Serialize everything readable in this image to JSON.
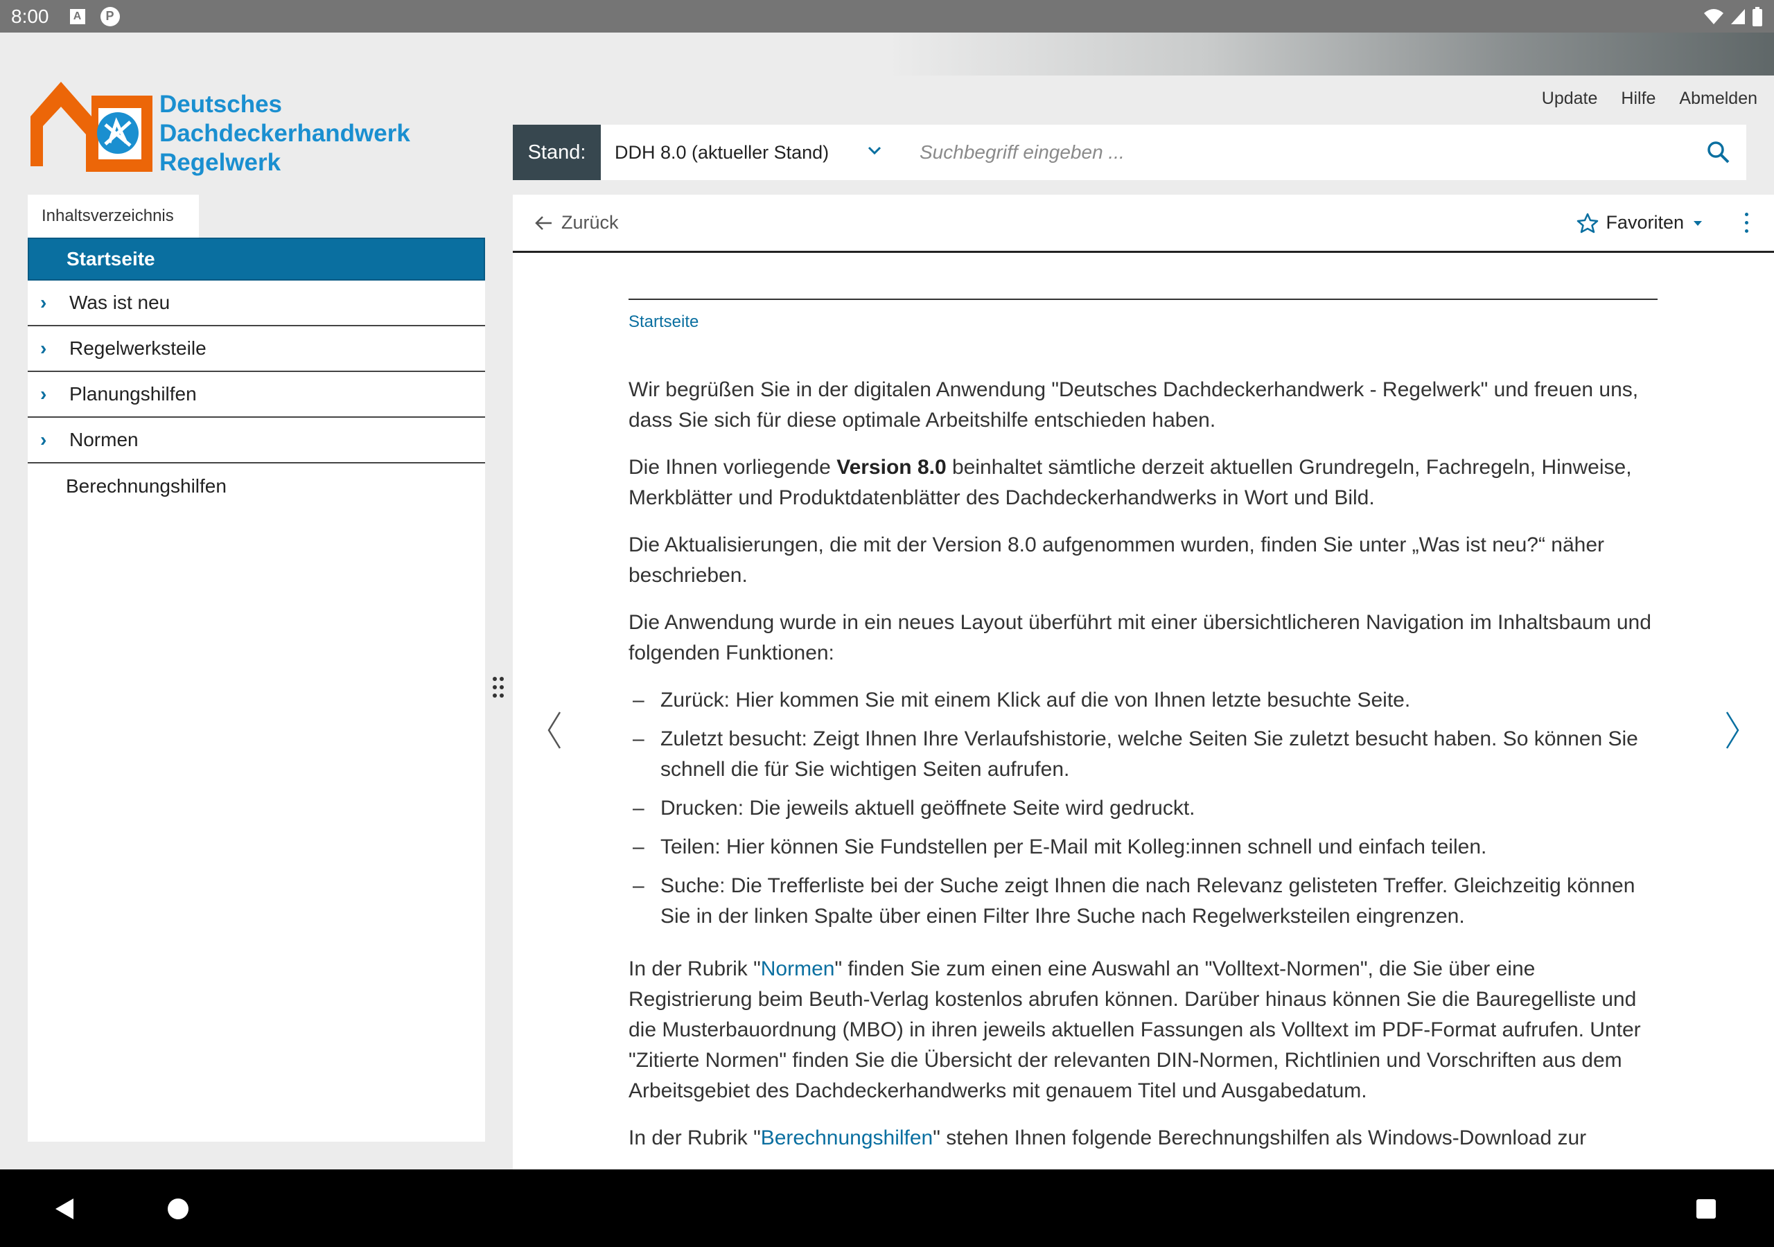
{
  "status_bar": {
    "time": "8:00",
    "icon_a": "A",
    "icon_p": "P"
  },
  "logo": {
    "line1": "Deutsches",
    "line2": "Dachdeckerhandwerk",
    "line3": "Regelwerk"
  },
  "top_links": {
    "update": "Update",
    "hilfe": "Hilfe",
    "abmelden": "Abmelden"
  },
  "stand": {
    "label": "Stand:",
    "selected": "DDH 8.0 (aktueller Stand)"
  },
  "search": {
    "placeholder": "Suchbegriff eingeben ..."
  },
  "sidebar": {
    "tab": "Inhaltsverzeichnis",
    "items": [
      {
        "label": "Startseite"
      },
      {
        "label": "Was ist neu"
      },
      {
        "label": "Regelwerksteile"
      },
      {
        "label": "Planungshilfen"
      },
      {
        "label": "Normen"
      },
      {
        "label": "Berechnungshilfen"
      }
    ]
  },
  "toolbar": {
    "back": "Zurück",
    "favorites": "Favoriten"
  },
  "content": {
    "breadcrumb": "Startseite",
    "p1": "Wir begrüßen Sie in der digitalen Anwendung \"Deutsches Dachdeckerhandwerk - Regelwerk\" und freuen uns, dass Sie sich für diese optimale Arbeitshilfe entschieden haben.",
    "p2_before": "Die Ihnen vorliegende ",
    "p2_bold": "Version 8.0",
    "p2_after": " beinhaltet sämtliche derzeit aktuellen Grundregeln, Fachregeln, Hinweise, Merkblätter und Produktdatenblätter des Dachdeckerhandwerks in Wort und Bild.",
    "p3": "Die Aktualisierungen, die mit der Version 8.0 aufgenommen wurden, finden Sie unter „Was ist neu?“ näher beschrieben.",
    "p4": "Die Anwendung wurde in ein neues Layout überführt mit einer übersichtlicheren Navigation im Inhaltsbaum und folgenden Funktionen:",
    "bullets": [
      "Zurück: Hier kommen Sie mit einem Klick auf die von Ihnen letzte besuchte Seite.",
      "Zuletzt besucht: Zeigt Ihnen Ihre Verlaufshistorie, welche Seiten Sie zuletzt besucht haben. So können Sie schnell die für Sie wichtigen Seiten aufrufen.",
      "Drucken: Die jeweils aktuell geöffnete Seite wird gedruckt.",
      "Teilen: Hier können Sie Fundstellen per E-Mail mit Kolleg:innen schnell und einfach teilen.",
      "Suche: Die Trefferliste bei der Suche zeigt Ihnen die nach Relevanz gelisteten Treffer. Gleichzeitig können Sie in der linken Spalte über einen Filter Ihre Suche nach Regelwerksteilen eingrenzen."
    ],
    "p5_before": "In der Rubrik \"",
    "p5_link": "Normen",
    "p5_after": "\" finden Sie zum einen eine Auswahl an \"Volltext-Normen\", die Sie über eine Registrierung beim Beuth-Verlag kostenlos abrufen können. Darüber hinaus können Sie die Bauregelliste und die Musterbauordnung (MBO) in ihren jeweils aktuellen Fassungen als Volltext im PDF-Format aufrufen. Unter \"Zitierte Normen\" finden Sie die Übersicht der relevanten DIN-Normen, Richtlinien und Vorschriften aus dem Arbeitsgebiet des Dachdeckerhandwerks mit genauem Titel und Ausgabedatum.",
    "p6_before": "In der Rubrik \"",
    "p6_link": "Berechnungshilfen",
    "p6_after": "\" stehen Ihnen folgende Berechnungshilfen als Windows-Download zur"
  },
  "colors": {
    "accent": "#0a6fa0",
    "logo_orange": "#ec6608",
    "logo_blue": "#1a8fd0",
    "stand_bg": "#37474f"
  },
  "icons": [
    "search-icon",
    "chevron-down-icon",
    "arrow-left-icon",
    "star-icon",
    "caret-down-icon",
    "more-vert-icon",
    "drag-handle-icon",
    "chevron-left-icon",
    "chevron-right-icon",
    "wifi-icon",
    "signal-icon",
    "battery-icon"
  ]
}
